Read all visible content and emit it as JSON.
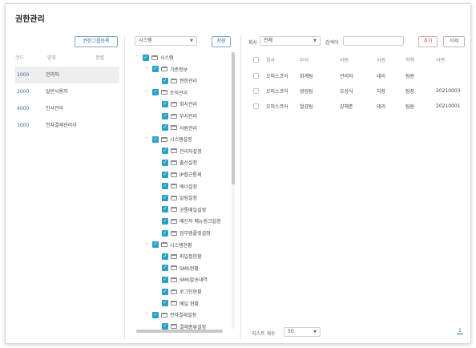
{
  "page": {
    "title": "권한관리"
  },
  "groups": {
    "add_button": "권한그룹등록",
    "headers": {
      "code": "코드",
      "name": "명칭",
      "status": "정렬"
    },
    "rows": [
      {
        "code": "1000",
        "name": "관리자",
        "selected": true
      },
      {
        "code": "2000",
        "name": "일반사용자",
        "selected": false
      },
      {
        "code": "4000",
        "name": "인사관리",
        "selected": false
      },
      {
        "code": "3000",
        "name": "전자결재관리자",
        "selected": false
      }
    ]
  },
  "menu_tree": {
    "type_select": "시스템",
    "save_button": "저장",
    "nodes": [
      "시스템",
      "기준정보",
      "권한관리",
      "조직관리",
      "회사관리",
      "부서관리",
      "사원관리",
      "시스템설정",
      "관리자설정",
      "출산설정",
      "IP접근통제",
      "배너설정",
      "알림설정",
      "공통메일설정",
      "메신저 메뉴링크설정",
      "업무템플릿설정",
      "시스템현황",
      "파일접현황",
      "SMS현황",
      "SMS발송내역",
      "로그인현황",
      "메일 현황",
      "전자결재설정",
      "결재종류설정"
    ]
  },
  "users": {
    "company_label": "회사",
    "company_select": "전체",
    "search_label": "검색어",
    "search_value": "",
    "add_button": "추가",
    "delete_button": "삭제",
    "headers": [
      "회사",
      "부서",
      "사원",
      "사원",
      "직책",
      "사번"
    ],
    "rows": [
      [
        "오피스코어",
        "회계팀",
        "관리자",
        "대리",
        "팀원",
        ""
      ],
      [
        "오피스코어",
        "영업팀",
        "오상식",
        "차장",
        "팀장",
        "20210003"
      ],
      [
        "오피스코어",
        "철강팀",
        "강해준",
        "대리",
        "팀원",
        "20210001"
      ]
    ],
    "page_size_label": "리스트 개수",
    "page_size": "50",
    "current_page": "1"
  }
}
